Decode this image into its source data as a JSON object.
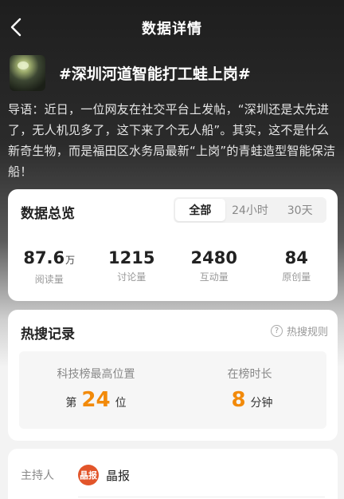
{
  "nav": {
    "title": "数据详情"
  },
  "topic": {
    "title": "#深圳河道智能打工蛙上岗#"
  },
  "intro": "导语：近日，一位网友在社交平台上发帖，“深圳还是太先进了，无人机见多了，这下来了个无人船”。其实，这不是什么新奇生物，而是福田区水务局最新“上岗”的青蛙造型智能保洁船！",
  "overview": {
    "title": "数据总览",
    "tabs": [
      {
        "label": "全部",
        "active": true
      },
      {
        "label": "24小时",
        "active": false
      },
      {
        "label": "30天",
        "active": false
      }
    ],
    "stats": [
      {
        "value": "87.6",
        "unit": "万",
        "label": "阅读量"
      },
      {
        "value": "1215",
        "unit": "",
        "label": "讨论量"
      },
      {
        "value": "2480",
        "unit": "",
        "label": "互动量"
      },
      {
        "value": "84",
        "unit": "",
        "label": "原创量"
      }
    ]
  },
  "hot": {
    "title": "热搜记录",
    "rules_label": "热搜规则",
    "help_glyph": "?",
    "best_rank": {
      "label": "科技榜最高位置",
      "prefix": "第",
      "value": "24",
      "suffix": "位"
    },
    "duration": {
      "label": "在榜时长",
      "value": "8",
      "suffix": "分钟"
    }
  },
  "host": {
    "label": "主持人",
    "avatar_text": "晶报",
    "name": "晶报"
  },
  "colors": {
    "accent": "#f28a0a",
    "avatar": "#e2552a"
  },
  "icons": {
    "back": "chevron-left-icon",
    "help": "question-circle-icon"
  }
}
